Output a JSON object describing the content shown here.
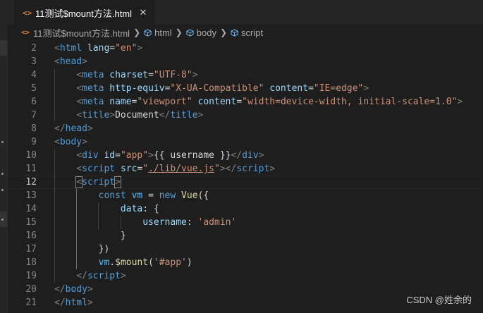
{
  "tab": {
    "icon": "<>",
    "title": "11测试$mount方法.html",
    "close": "✕"
  },
  "breadcrumb": [
    {
      "label": "11测试$mount方法.html",
      "icon": "html-file-icon"
    },
    {
      "label": "html",
      "icon": "symbol-cube-icon"
    },
    {
      "label": "body",
      "icon": "symbol-cube-icon"
    },
    {
      "label": "script",
      "icon": "symbol-cube-icon"
    }
  ],
  "editor": {
    "active_line": 12,
    "lines": [
      {
        "n": "2",
        "t": [
          [
            "punct",
            "<"
          ],
          [
            "tag",
            "html"
          ],
          [
            "text",
            " "
          ],
          [
            "attr",
            "lang"
          ],
          [
            "text",
            "="
          ],
          [
            "str",
            "\"en\""
          ],
          [
            "punct",
            ">"
          ]
        ]
      },
      {
        "n": "3",
        "t": [
          [
            "punct",
            "<"
          ],
          [
            "tag",
            "head"
          ],
          [
            "punct",
            ">"
          ]
        ]
      },
      {
        "n": "4",
        "t": [
          [
            "text",
            "    "
          ],
          [
            "punct",
            "<"
          ],
          [
            "tag",
            "meta"
          ],
          [
            "text",
            " "
          ],
          [
            "attr",
            "charset"
          ],
          [
            "text",
            "="
          ],
          [
            "str",
            "\"UTF-8\""
          ],
          [
            "punct",
            ">"
          ]
        ]
      },
      {
        "n": "5",
        "t": [
          [
            "text",
            "    "
          ],
          [
            "punct",
            "<"
          ],
          [
            "tag",
            "meta"
          ],
          [
            "text",
            " "
          ],
          [
            "attr",
            "http-equiv"
          ],
          [
            "text",
            "="
          ],
          [
            "str",
            "\"X-UA-Compatible\""
          ],
          [
            "text",
            " "
          ],
          [
            "attr",
            "content"
          ],
          [
            "text",
            "="
          ],
          [
            "str",
            "\"IE=edge\""
          ],
          [
            "punct",
            ">"
          ]
        ]
      },
      {
        "n": "6",
        "t": [
          [
            "text",
            "    "
          ],
          [
            "punct",
            "<"
          ],
          [
            "tag",
            "meta"
          ],
          [
            "text",
            " "
          ],
          [
            "attr",
            "name"
          ],
          [
            "text",
            "="
          ],
          [
            "str",
            "\"viewport\""
          ],
          [
            "text",
            " "
          ],
          [
            "attr",
            "content"
          ],
          [
            "text",
            "="
          ],
          [
            "str",
            "\"width=device-width, initial-scale=1.0\""
          ],
          [
            "punct",
            ">"
          ]
        ]
      },
      {
        "n": "7",
        "t": [
          [
            "text",
            "    "
          ],
          [
            "punct",
            "<"
          ],
          [
            "tag",
            "title"
          ],
          [
            "punct",
            ">"
          ],
          [
            "text",
            "Document"
          ],
          [
            "punct",
            "</"
          ],
          [
            "tag",
            "title"
          ],
          [
            "punct",
            ">"
          ]
        ]
      },
      {
        "n": "8",
        "t": [
          [
            "punct",
            "</"
          ],
          [
            "tag",
            "head"
          ],
          [
            "punct",
            ">"
          ]
        ]
      },
      {
        "n": "9",
        "t": [
          [
            "punct",
            "<"
          ],
          [
            "tag",
            "body"
          ],
          [
            "punct",
            ">"
          ]
        ]
      },
      {
        "n": "10",
        "t": [
          [
            "text",
            "    "
          ],
          [
            "punct",
            "<"
          ],
          [
            "tag",
            "div"
          ],
          [
            "text",
            " "
          ],
          [
            "attr",
            "id"
          ],
          [
            "text",
            "="
          ],
          [
            "str",
            "\"app\""
          ],
          [
            "punct",
            ">"
          ],
          [
            "text",
            "{{ username }}"
          ],
          [
            "punct",
            "</"
          ],
          [
            "tag",
            "div"
          ],
          [
            "punct",
            ">"
          ]
        ]
      },
      {
        "n": "11",
        "t": [
          [
            "text",
            "    "
          ],
          [
            "punct",
            "<"
          ],
          [
            "tag",
            "script"
          ],
          [
            "text",
            " "
          ],
          [
            "attr",
            "src"
          ],
          [
            "text",
            "="
          ],
          [
            "str",
            "\""
          ],
          [
            "link",
            "./lib/vue.js"
          ],
          [
            "str",
            "\""
          ],
          [
            "punct",
            "></"
          ],
          [
            "tag",
            "script"
          ],
          [
            "punct",
            ">"
          ]
        ]
      },
      {
        "n": "12",
        "t": [
          [
            "text",
            "    "
          ],
          [
            "punctbox",
            "<"
          ],
          [
            "tag",
            "script"
          ],
          [
            "punctbox",
            ">"
          ],
          [
            "cursor",
            ""
          ]
        ]
      },
      {
        "n": "13",
        "t": [
          [
            "text",
            "        "
          ],
          [
            "kw",
            "const"
          ],
          [
            "text",
            " "
          ],
          [
            "var",
            "vm"
          ],
          [
            "text",
            " = "
          ],
          [
            "kw",
            "new"
          ],
          [
            "text",
            " "
          ],
          [
            "fn",
            "Vue"
          ],
          [
            "text",
            "({"
          ]
        ]
      },
      {
        "n": "14",
        "t": [
          [
            "text",
            "            "
          ],
          [
            "prop",
            "data"
          ],
          [
            "text",
            ": {"
          ]
        ]
      },
      {
        "n": "15",
        "t": [
          [
            "text",
            "                "
          ],
          [
            "prop",
            "username"
          ],
          [
            "text",
            ": "
          ],
          [
            "str",
            "'admin'"
          ]
        ]
      },
      {
        "n": "16",
        "t": [
          [
            "text",
            "            }"
          ]
        ]
      },
      {
        "n": "17",
        "t": [
          [
            "text",
            "        })"
          ]
        ]
      },
      {
        "n": "18",
        "t": [
          [
            "text",
            "        "
          ],
          [
            "var",
            "vm"
          ],
          [
            "text",
            "."
          ],
          [
            "fn",
            "$mount"
          ],
          [
            "text",
            "("
          ],
          [
            "str",
            "'#app'"
          ],
          [
            "text",
            ")"
          ]
        ]
      },
      {
        "n": "19",
        "t": [
          [
            "text",
            "    "
          ],
          [
            "punct",
            "</"
          ],
          [
            "tag",
            "script"
          ],
          [
            "punct",
            ">"
          ]
        ]
      },
      {
        "n": "20",
        "t": [
          [
            "punct",
            "</"
          ],
          [
            "tag",
            "body"
          ],
          [
            "punct",
            ">"
          ]
        ]
      },
      {
        "n": "21",
        "t": [
          [
            "punct",
            "</"
          ],
          [
            "tag",
            "html"
          ],
          [
            "punct",
            ">"
          ]
        ]
      }
    ]
  },
  "watermark": "CSDN @姓余的"
}
